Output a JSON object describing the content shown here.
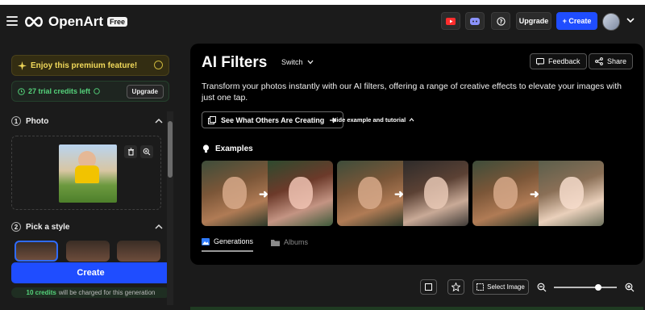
{
  "header": {
    "logo": "OpenArt",
    "badge": "Free",
    "upgrade_label": "Upgrade",
    "create_label": "+ Create",
    "icons": [
      "youtube-icon",
      "discord-icon",
      "help-icon"
    ]
  },
  "sidebar": {
    "premium_text": "Enjoy this premium feature!",
    "trial_text": "27 trial credits left",
    "trial_upgrade": "Upgrade",
    "step1": {
      "num": "1",
      "label": "Photo"
    },
    "step2": {
      "num": "2",
      "label": "Pick a style"
    },
    "create_label": "Create",
    "credits_bold": "10 credits",
    "credits_rest": "will be charged for this generation"
  },
  "main": {
    "title": "AI Filters",
    "switch_label": "Switch",
    "feedback_label": "Feedback",
    "share_label": "Share",
    "description": "Transform your photos instantly with our AI filters, offering a range of creative effects to elevate your images with just one tap.",
    "see_others_label": "See What Others Are Creating",
    "hide_label": "Hide example and tutorial",
    "examples_label": "Examples",
    "tabs": [
      {
        "label": "Generations",
        "active": true
      },
      {
        "label": "Albums",
        "active": false
      }
    ]
  },
  "toolbar": {
    "select_image_label": "Select Image",
    "zoom_level": 0.7
  },
  "colors": {
    "accent": "#1f4dff",
    "credits_green": "#55d37b",
    "premium_yellow": "#f1d95a"
  }
}
